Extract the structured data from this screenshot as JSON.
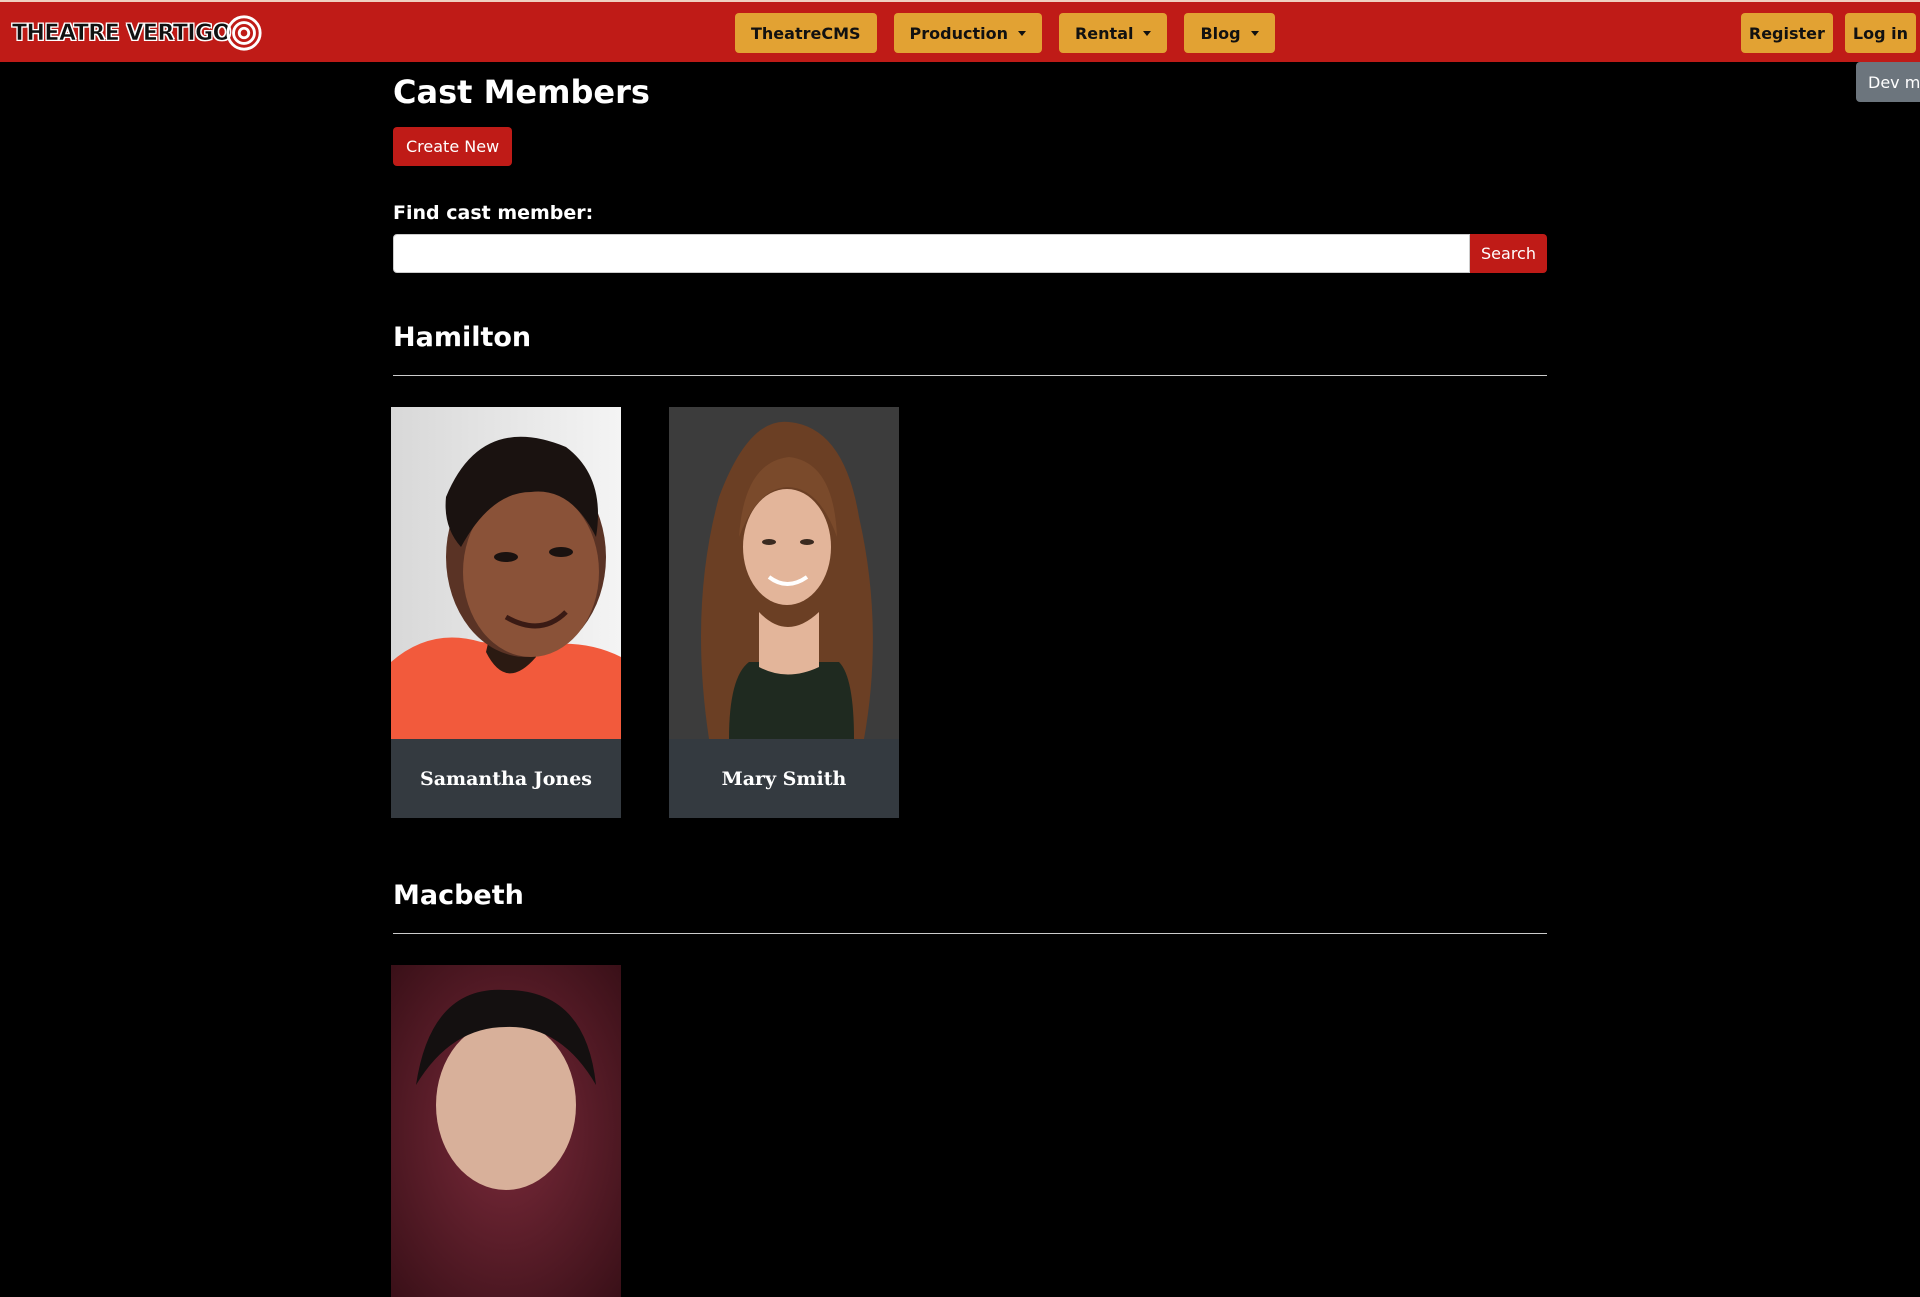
{
  "navbar": {
    "logo_text": "THEATRE VERTIGO",
    "menu": [
      {
        "label": "TheatreCMS",
        "has_dropdown": false
      },
      {
        "label": "Production",
        "has_dropdown": true
      },
      {
        "label": "Rental",
        "has_dropdown": true
      },
      {
        "label": "Blog",
        "has_dropdown": true
      }
    ],
    "register_label": "Register",
    "login_label": "Log in"
  },
  "dev_tab_label": "Dev me",
  "page": {
    "title": "Cast Members",
    "create_new_label": "Create New",
    "find_label": "Find cast member:",
    "search_value": "",
    "search_button_label": "Search"
  },
  "sections": [
    {
      "title": "Hamilton",
      "members": [
        {
          "name": "Samantha Jones"
        },
        {
          "name": "Mary Smith"
        }
      ]
    },
    {
      "title": "Macbeth",
      "members": [
        {
          "name": ""
        }
      ]
    }
  ],
  "colors": {
    "brand_red": "#bf1b17",
    "nav_button": "#e2a233",
    "card_footer": "#343a40",
    "background": "#000000"
  }
}
